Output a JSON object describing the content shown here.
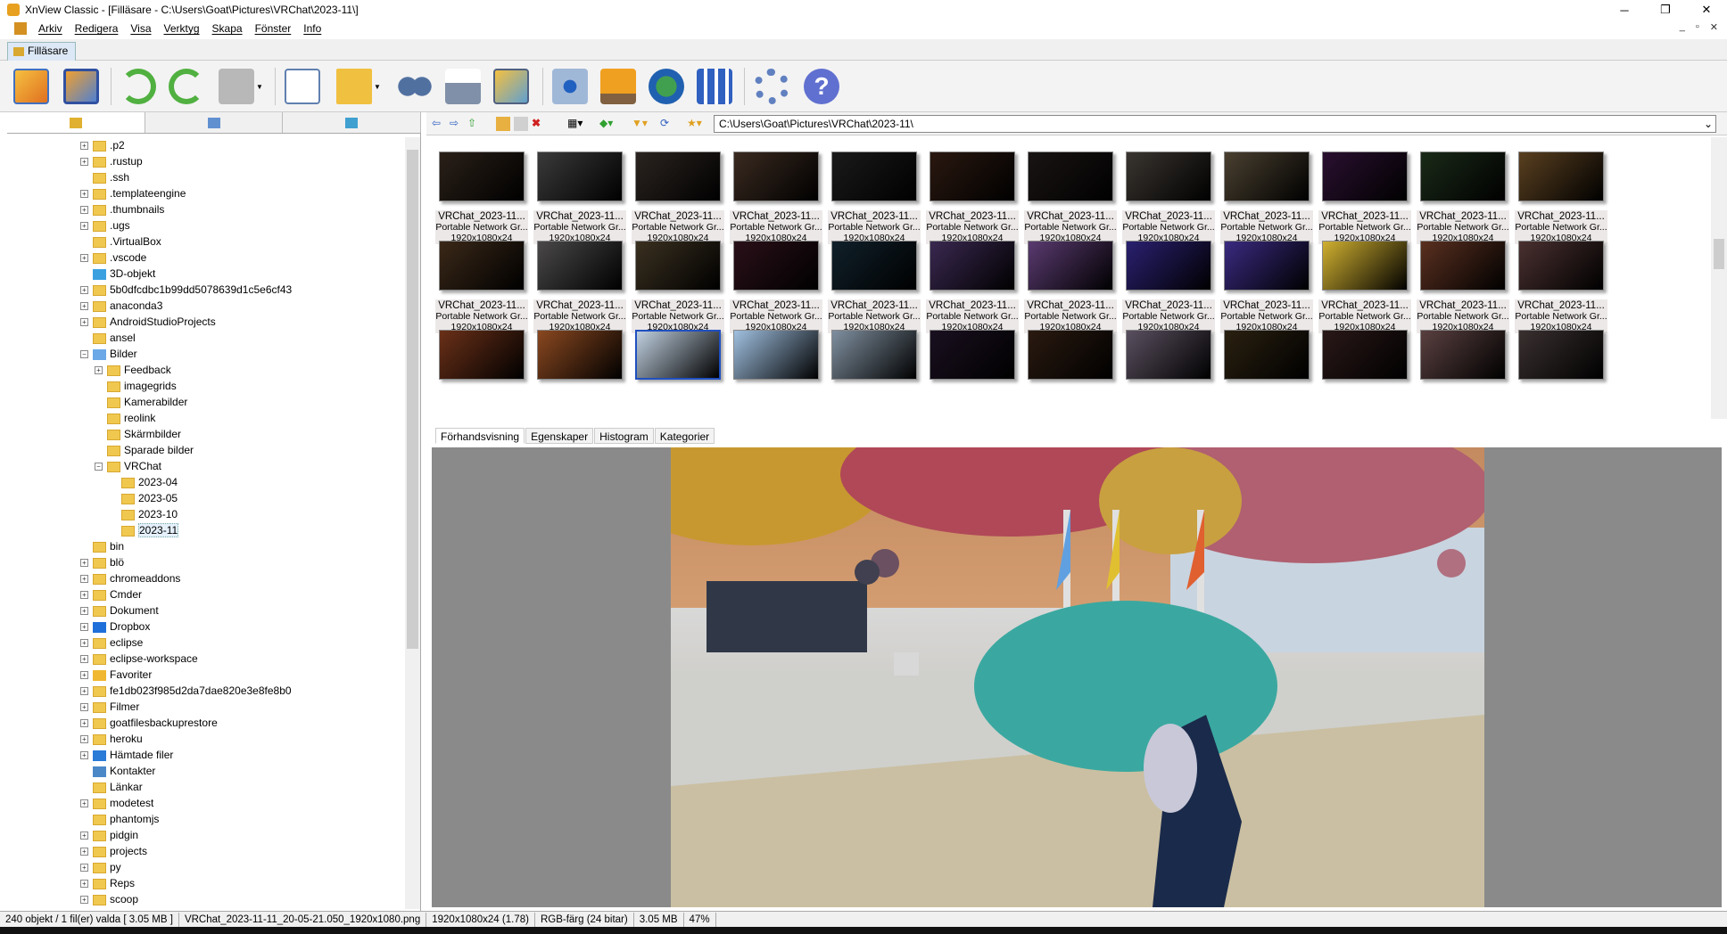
{
  "window": {
    "title": "XnView Classic - [Filläsare - C:\\Users\\Goat\\Pictures\\VRChat\\2023-11\\]",
    "minimize": "─",
    "restore": "❐",
    "close": "✕"
  },
  "menu": [
    "Arkiv",
    "Redigera",
    "Visa",
    "Verktyg",
    "Skapa",
    "Fönster",
    "Info"
  ],
  "tabs": {
    "active": "Filläsare"
  },
  "toolbar_icons": [
    "browser-icon",
    "fullscreen-icon",
    "rotate-left-icon",
    "rotate-right-icon",
    "transform-icon",
    "properties-icon",
    "export-icon",
    "find-icon",
    "print-icon",
    "convert-icon",
    "capture-icon",
    "slideshow-icon",
    "webpage-icon",
    "contact-sheet-icon",
    "settings-icon",
    "help-icon"
  ],
  "address": {
    "path": "C:\\Users\\Goat\\Pictures\\VRChat\\2023-11\\"
  },
  "tree": [
    {
      "label": ".p2",
      "indent": 1,
      "exp": true
    },
    {
      "label": ".rustup",
      "indent": 1,
      "exp": true
    },
    {
      "label": ".ssh",
      "indent": 1,
      "exp": false
    },
    {
      "label": ".templateengine",
      "indent": 1,
      "exp": true
    },
    {
      "label": ".thumbnails",
      "indent": 1,
      "exp": true
    },
    {
      "label": ".ugs",
      "indent": 1,
      "exp": true
    },
    {
      "label": ".VirtualBox",
      "indent": 1,
      "exp": false
    },
    {
      "label": ".vscode",
      "indent": 1,
      "exp": true
    },
    {
      "label": "3D-objekt",
      "indent": 1,
      "exp": false,
      "icon": "#3aa0e0"
    },
    {
      "label": "5b0dfcdbc1b99dd5078639d1c5e6cf43",
      "indent": 1,
      "exp": true
    },
    {
      "label": "anaconda3",
      "indent": 1,
      "exp": true
    },
    {
      "label": "AndroidStudioProjects",
      "indent": 1,
      "exp": true
    },
    {
      "label": "ansel",
      "indent": 1,
      "exp": false
    },
    {
      "label": "Bilder",
      "indent": 1,
      "exp": true,
      "open": true,
      "icon": "#6aa8e8"
    },
    {
      "label": "Feedback",
      "indent": 2,
      "exp": true
    },
    {
      "label": "imagegrids",
      "indent": 2,
      "exp": false
    },
    {
      "label": "Kamerabilder",
      "indent": 2,
      "exp": false
    },
    {
      "label": "reolink",
      "indent": 2,
      "exp": false
    },
    {
      "label": "Skärmbilder",
      "indent": 2,
      "exp": false
    },
    {
      "label": "Sparade bilder",
      "indent": 2,
      "exp": false
    },
    {
      "label": "VRChat",
      "indent": 2,
      "exp": true,
      "open": true
    },
    {
      "label": "2023-04",
      "indent": 3,
      "exp": false
    },
    {
      "label": "2023-05",
      "indent": 3,
      "exp": false
    },
    {
      "label": "2023-10",
      "indent": 3,
      "exp": false
    },
    {
      "label": "2023-11",
      "indent": 3,
      "exp": false,
      "selected": true
    },
    {
      "label": "bin",
      "indent": 1,
      "exp": false
    },
    {
      "label": "blö",
      "indent": 1,
      "exp": true
    },
    {
      "label": "chromeaddons",
      "indent": 1,
      "exp": true
    },
    {
      "label": "Cmder",
      "indent": 1,
      "exp": true
    },
    {
      "label": "Dokument",
      "indent": 1,
      "exp": true
    },
    {
      "label": "Dropbox",
      "indent": 1,
      "exp": true,
      "icon": "#1e6fd9"
    },
    {
      "label": "eclipse",
      "indent": 1,
      "exp": true
    },
    {
      "label": "eclipse-workspace",
      "indent": 1,
      "exp": true
    },
    {
      "label": "Favoriter",
      "indent": 1,
      "exp": true,
      "icon": "#f0b830"
    },
    {
      "label": "fe1db023f985d2da7dae820e3e8fe8b0",
      "indent": 1,
      "exp": true
    },
    {
      "label": "Filmer",
      "indent": 1,
      "exp": true
    },
    {
      "label": "goatfilesbackuprestore",
      "indent": 1,
      "exp": true
    },
    {
      "label": "heroku",
      "indent": 1,
      "exp": true
    },
    {
      "label": "Hämtade filer",
      "indent": 1,
      "exp": true,
      "icon": "#2a7ad8"
    },
    {
      "label": "Kontakter",
      "indent": 1,
      "exp": false,
      "icon": "#4a88c8"
    },
    {
      "label": "Länkar",
      "indent": 1,
      "exp": false
    },
    {
      "label": "modetest",
      "indent": 1,
      "exp": true
    },
    {
      "label": "phantomjs",
      "indent": 1,
      "exp": false
    },
    {
      "label": "pidgin",
      "indent": 1,
      "exp": true
    },
    {
      "label": "projects",
      "indent": 1,
      "exp": true
    },
    {
      "label": "py",
      "indent": 1,
      "exp": true
    },
    {
      "label": "Reps",
      "indent": 1,
      "exp": true
    },
    {
      "label": "scoop",
      "indent": 1,
      "exp": true
    }
  ],
  "thumb_meta": {
    "name": "VRChat_2023-11...",
    "type": "Portable Network Gr...",
    "dims": "1920x1080x24"
  },
  "thumb_rows": [
    [
      "#2a2018",
      "#3a3a3a",
      "#2b2420",
      "#3a2a20",
      "#1a1a1a",
      "#2a1810",
      "#1a1414",
      "#3a3530",
      "#4a4030",
      "#2a1030",
      "#1a2a18",
      "#5a4020"
    ],
    [
      "#3a2818",
      "#4a4848",
      "#3a3020",
      "#2a1018",
      "#10202a",
      "#3a2850",
      "#5a3a70",
      "#2a2070",
      "#3a2a80",
      "#d0b030",
      "#5a3020",
      "#4a3030"
    ],
    [
      "#6a3018",
      "#8a4820",
      "#c0d0e0",
      "#a0c0e0",
      "#8090a0",
      "#1a1020",
      "#2a1a10",
      "#5a5060",
      "#2a2010",
      "#2a1818",
      "#5a4040",
      "#3a3030"
    ]
  ],
  "preview_tabs": [
    "Förhandsvisning",
    "Egenskaper",
    "Histogram",
    "Kategorier"
  ],
  "status": [
    "240 objekt / 1 fil(er) valda  [ 3.05 MB ]",
    "VRChat_2023-11-11_20-05-21.050_1920x1080.png",
    "1920x1080x24 (1.78)",
    "RGB-färg (24 bitar)",
    "3.05 MB",
    "47%"
  ]
}
